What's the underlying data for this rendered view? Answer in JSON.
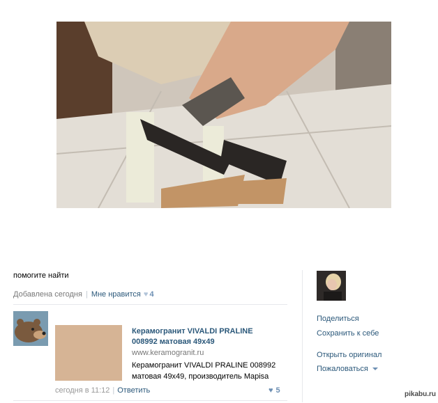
{
  "post": {
    "text": "помогите найти",
    "added": "Добавлена сегодня",
    "like_label": "Мне нравится",
    "like_count": "4"
  },
  "comment": {
    "card_title": "Керамогранит VIVALDI PRALINE 008992 матовая 49x49",
    "card_domain": "www.keramogranit.ru",
    "card_desc": "Керамогранит VIVALDI PRALINE 008992 матовая 49x49, производитель Mapisa",
    "time": "сегодня в 11:12",
    "reply_label": "Ответить",
    "like_count": "5"
  },
  "sidebar": {
    "share": "Поделиться",
    "save": "Сохранить к себе",
    "open_original": "Открыть оригинал",
    "report": "Пожаловаться"
  },
  "watermark": "pikabu.ru",
  "colors": {
    "link": "#2b587a",
    "muted": "#777777",
    "tile": "#d6b495"
  }
}
